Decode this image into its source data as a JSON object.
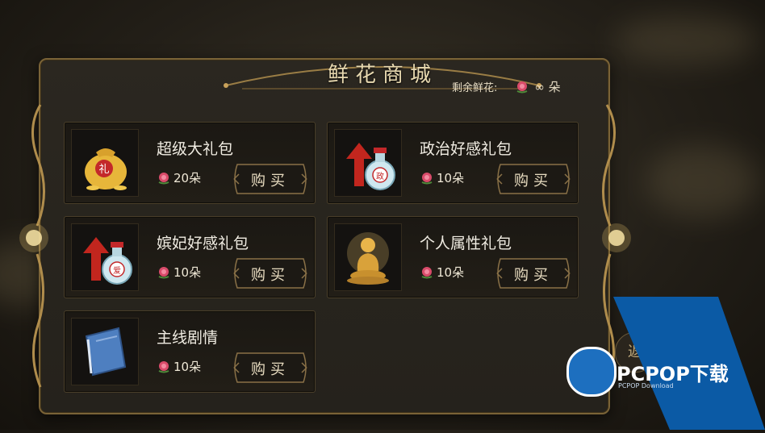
{
  "title": "鲜花商城",
  "remaining": {
    "label": "剩余鲜花:",
    "value": "∞ 朵"
  },
  "buy_label": "购买",
  "items": [
    {
      "name": "超级大礼包",
      "price": "20朵",
      "icon": "money-bag-icon"
    },
    {
      "name": "政治好感礼包",
      "price": "10朵",
      "icon": "politics-potion-icon"
    },
    {
      "name": "嫔妃好感礼包",
      "price": "10朵",
      "icon": "love-potion-icon"
    },
    {
      "name": "个人属性礼包",
      "price": "10朵",
      "icon": "golden-buddha-icon"
    },
    {
      "name": "主线剧情",
      "price": "10朵",
      "icon": "story-book-icon"
    }
  ],
  "back_label": "返",
  "watermark": {
    "brand": "PCPOP下载",
    "sub": "PCPOP Download"
  },
  "colors": {
    "gold": "#c9a25a",
    "flower": "#d94b6a",
    "panel": "#27231c",
    "watermark_blue": "#0b5aa5"
  }
}
